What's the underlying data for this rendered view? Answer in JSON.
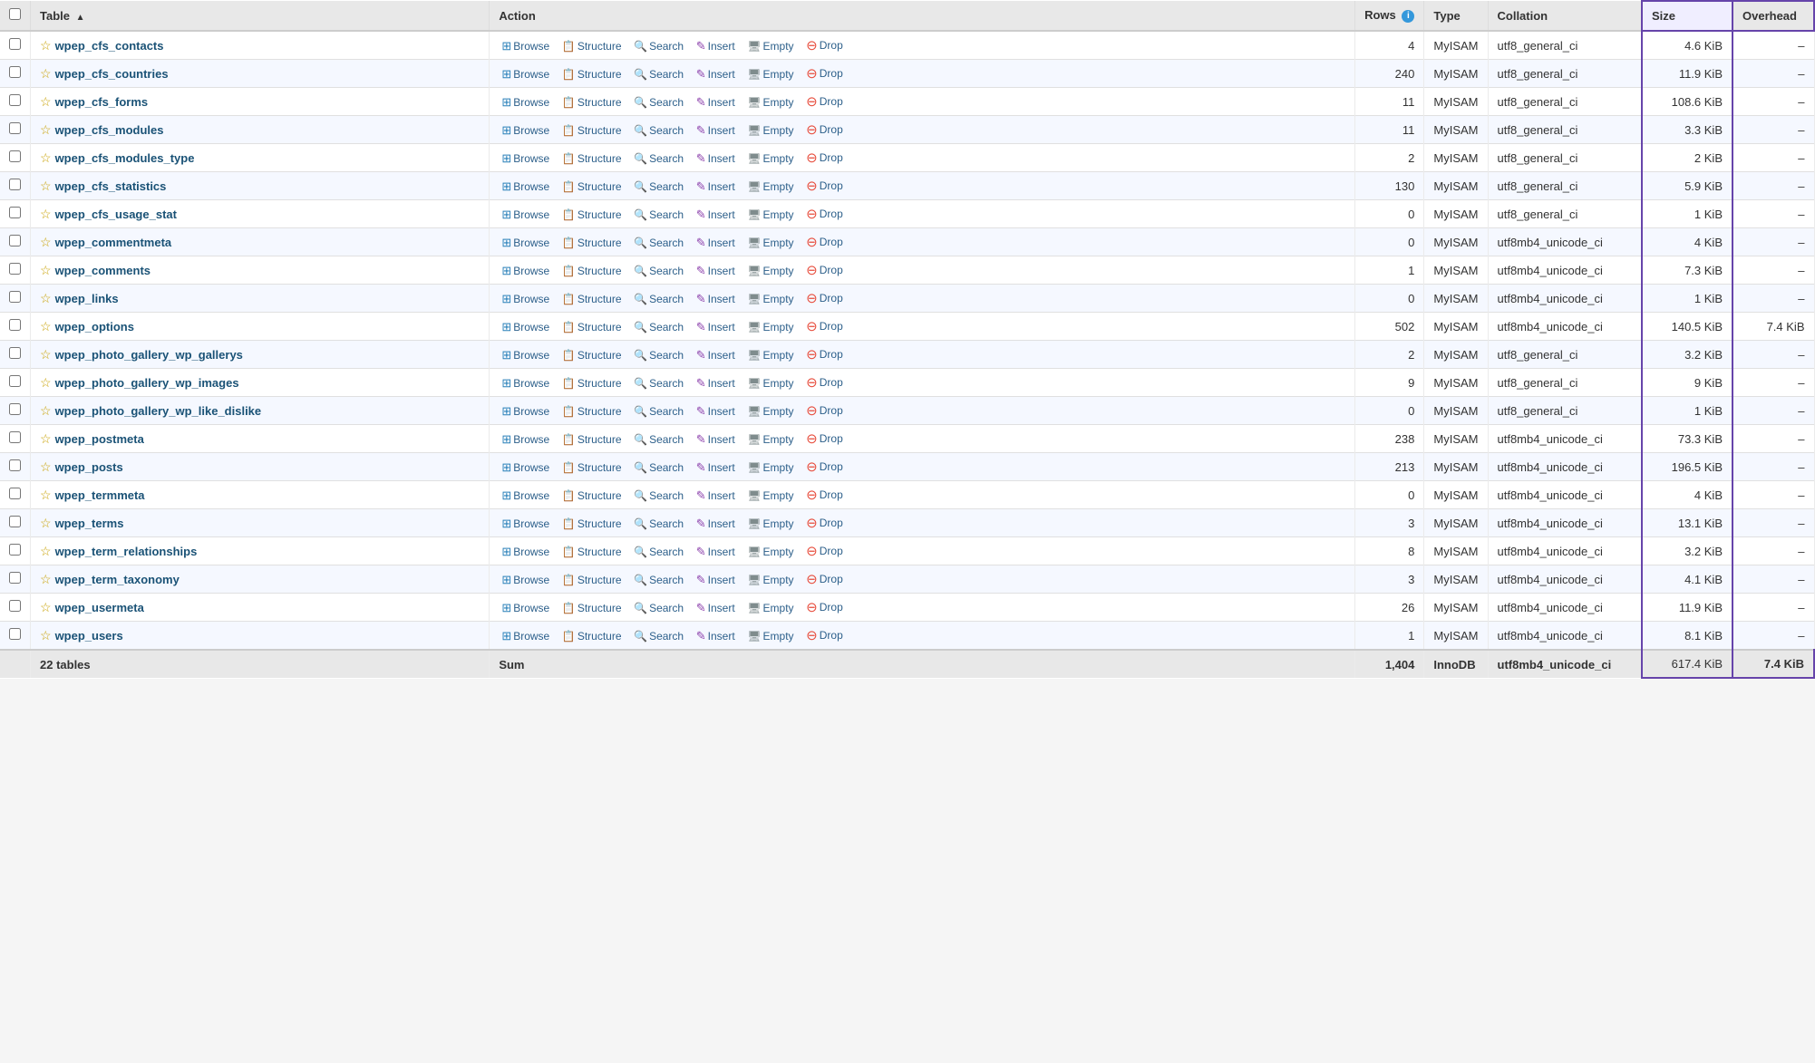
{
  "header": {
    "columns": [
      "",
      "Table",
      "Action",
      "",
      "Rows",
      "rowsInfo",
      "Type",
      "Collation",
      "Size",
      "Overhead"
    ]
  },
  "rows": [
    {
      "name": "wpep_cfs_contacts",
      "rows": 4,
      "type": "MyISAM",
      "collation": "utf8_general_ci",
      "size": "4.6 KiB",
      "overhead": "–"
    },
    {
      "name": "wpep_cfs_countries",
      "rows": 240,
      "type": "MyISAM",
      "collation": "utf8_general_ci",
      "size": "11.9 KiB",
      "overhead": "–"
    },
    {
      "name": "wpep_cfs_forms",
      "rows": 11,
      "type": "MyISAM",
      "collation": "utf8_general_ci",
      "size": "108.6 KiB",
      "overhead": "–"
    },
    {
      "name": "wpep_cfs_modules",
      "rows": 11,
      "type": "MyISAM",
      "collation": "utf8_general_ci",
      "size": "3.3 KiB",
      "overhead": "–"
    },
    {
      "name": "wpep_cfs_modules_type",
      "rows": 2,
      "type": "MyISAM",
      "collation": "utf8_general_ci",
      "size": "2 KiB",
      "overhead": "–"
    },
    {
      "name": "wpep_cfs_statistics",
      "rows": 130,
      "type": "MyISAM",
      "collation": "utf8_general_ci",
      "size": "5.9 KiB",
      "overhead": "–"
    },
    {
      "name": "wpep_cfs_usage_stat",
      "rows": 0,
      "type": "MyISAM",
      "collation": "utf8_general_ci",
      "size": "1 KiB",
      "overhead": "–"
    },
    {
      "name": "wpep_commentmeta",
      "rows": 0,
      "type": "MyISAM",
      "collation": "utf8mb4_unicode_ci",
      "size": "4 KiB",
      "overhead": "–"
    },
    {
      "name": "wpep_comments",
      "rows": 1,
      "type": "MyISAM",
      "collation": "utf8mb4_unicode_ci",
      "size": "7.3 KiB",
      "overhead": "–"
    },
    {
      "name": "wpep_links",
      "rows": 0,
      "type": "MyISAM",
      "collation": "utf8mb4_unicode_ci",
      "size": "1 KiB",
      "overhead": "–"
    },
    {
      "name": "wpep_options",
      "rows": 502,
      "type": "MyISAM",
      "collation": "utf8mb4_unicode_ci",
      "size": "140.5 KiB",
      "overhead": "7.4 KiB"
    },
    {
      "name": "wpep_photo_gallery_wp_gallerys",
      "rows": 2,
      "type": "MyISAM",
      "collation": "utf8_general_ci",
      "size": "3.2 KiB",
      "overhead": "–"
    },
    {
      "name": "wpep_photo_gallery_wp_images",
      "rows": 9,
      "type": "MyISAM",
      "collation": "utf8_general_ci",
      "size": "9 KiB",
      "overhead": "–"
    },
    {
      "name": "wpep_photo_gallery_wp_like_dislike",
      "rows": 0,
      "type": "MyISAM",
      "collation": "utf8_general_ci",
      "size": "1 KiB",
      "overhead": "–"
    },
    {
      "name": "wpep_postmeta",
      "rows": 238,
      "type": "MyISAM",
      "collation": "utf8mb4_unicode_ci",
      "size": "73.3 KiB",
      "overhead": "–"
    },
    {
      "name": "wpep_posts",
      "rows": 213,
      "type": "MyISAM",
      "collation": "utf8mb4_unicode_ci",
      "size": "196.5 KiB",
      "overhead": "–"
    },
    {
      "name": "wpep_termmeta",
      "rows": 0,
      "type": "MyISAM",
      "collation": "utf8mb4_unicode_ci",
      "size": "4 KiB",
      "overhead": "–"
    },
    {
      "name": "wpep_terms",
      "rows": 3,
      "type": "MyISAM",
      "collation": "utf8mb4_unicode_ci",
      "size": "13.1 KiB",
      "overhead": "–"
    },
    {
      "name": "wpep_term_relationships",
      "rows": 8,
      "type": "MyISAM",
      "collation": "utf8mb4_unicode_ci",
      "size": "3.2 KiB",
      "overhead": "–"
    },
    {
      "name": "wpep_term_taxonomy",
      "rows": 3,
      "type": "MyISAM",
      "collation": "utf8mb4_unicode_ci",
      "size": "4.1 KiB",
      "overhead": "–"
    },
    {
      "name": "wpep_usermeta",
      "rows": 26,
      "type": "MyISAM",
      "collation": "utf8mb4_unicode_ci",
      "size": "11.9 KiB",
      "overhead": "–"
    },
    {
      "name": "wpep_users",
      "rows": 1,
      "type": "MyISAM",
      "collation": "utf8mb4_unicode_ci",
      "size": "8.1 KiB",
      "overhead": "–"
    }
  ],
  "footer": {
    "label": "22 tables",
    "sum": "Sum",
    "totalRows": "1,404",
    "totalType": "InnoDB",
    "totalCollation": "utf8mb4_unicode_ci",
    "totalSize": "617.4 KiB",
    "totalOverhead": "7.4 KiB"
  },
  "actions": {
    "browse": "Browse",
    "structure": "Structure",
    "search": "Search",
    "insert": "Insert",
    "empty": "Empty",
    "drop": "Drop"
  }
}
